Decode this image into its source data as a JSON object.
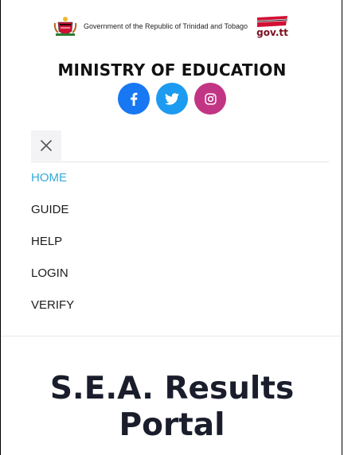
{
  "header": {
    "government_text": "Government of the Republic of Trinidad and Tobago",
    "govtt_logo_text": "gov.tt",
    "ministry_title": "MINISTRY OF EDUCATION"
  },
  "socials": [
    {
      "name": "facebook",
      "icon": "facebook-icon",
      "color": "#1877f2"
    },
    {
      "name": "twitter",
      "icon": "twitter-icon",
      "color": "#1d9bf0"
    },
    {
      "name": "instagram",
      "icon": "instagram-icon",
      "color": "#c13584"
    }
  ],
  "menu": {
    "close_icon": "close-icon",
    "items": [
      {
        "label": "HOME",
        "active": true
      },
      {
        "label": "GUIDE",
        "active": false
      },
      {
        "label": "HELP",
        "active": false
      },
      {
        "label": "LOGIN",
        "active": false
      },
      {
        "label": "VERIFY",
        "active": false
      }
    ]
  },
  "hero": {
    "title_line1": "S.E.A. Results",
    "title_line2": "Portal"
  },
  "colors": {
    "accent": "#36a9d9",
    "text": "#1b1b1b",
    "title": "#1a1d2b"
  }
}
